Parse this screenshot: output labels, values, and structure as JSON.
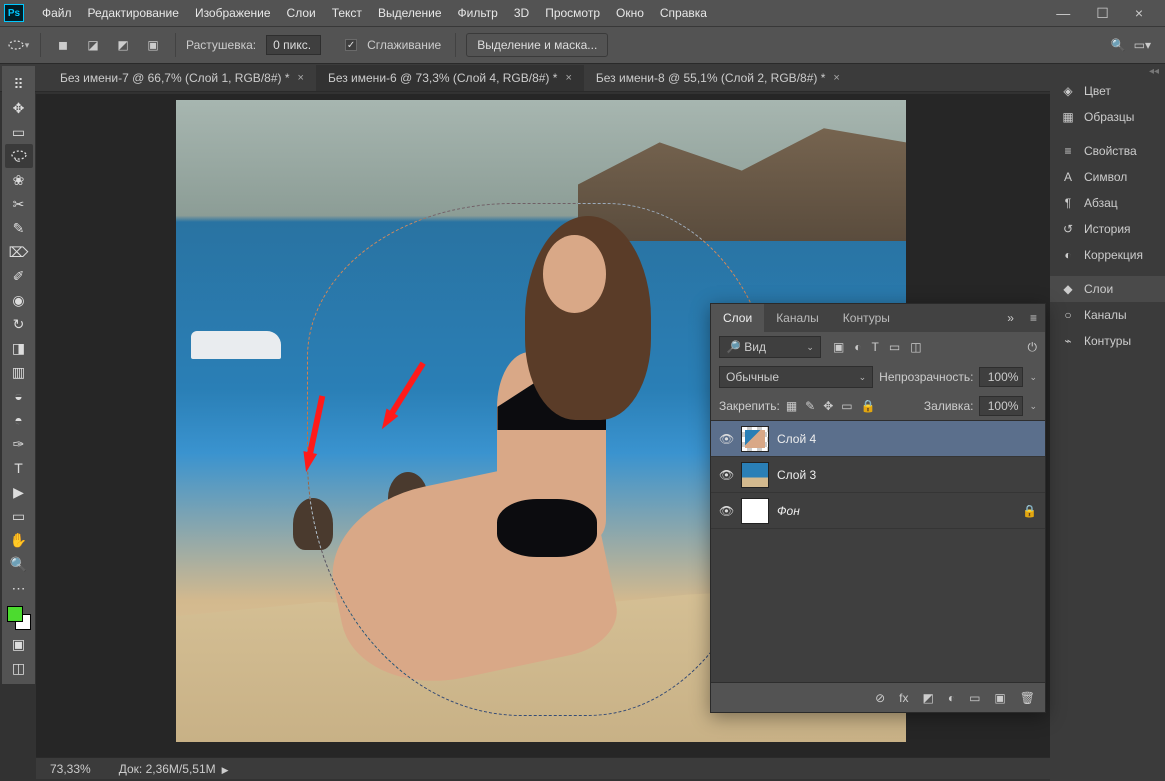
{
  "app": {
    "logo": "Ps"
  },
  "menu": [
    "Файл",
    "Редактирование",
    "Изображение",
    "Слои",
    "Текст",
    "Выделение",
    "Фильтр",
    "3D",
    "Просмотр",
    "Окно",
    "Справка"
  ],
  "window_controls": {
    "minimize": "—",
    "maximize": "☐",
    "close": "×"
  },
  "options": {
    "feather_label": "Растушевка:",
    "feather_value": "0 пикс.",
    "antialias_label": "Сглаживание",
    "antialias_checked": "✓",
    "select_mask_btn": "Выделение и маска..."
  },
  "doc_tabs": [
    {
      "label": "Без имени-7 @ 66,7% (Слой 1, RGB/8#) *",
      "active": false
    },
    {
      "label": "Без имени-6 @ 73,3% (Слой 4, RGB/8#) *",
      "active": true
    },
    {
      "label": "Без имени-8 @ 55,1% (Слой 2, RGB/8#) *",
      "active": false
    }
  ],
  "tools": [
    "↔",
    "▭",
    "◯",
    "○",
    "✦",
    "✂",
    "⁜",
    "✎",
    "⌫",
    "▱",
    "✏",
    "◑",
    "△",
    "●",
    "✍",
    "…",
    "✑",
    "T",
    "▲",
    "▭",
    "✋",
    "🔍"
  ],
  "status": {
    "zoom": "73,33%",
    "doc_label": "Док:",
    "doc_value": "2,36M/5,51M"
  },
  "rail_groups": [
    [
      {
        "icon": "◈",
        "label": "Цвет"
      },
      {
        "icon": "▦",
        "label": "Образцы"
      }
    ],
    [
      {
        "icon": "≡",
        "label": "Свойства"
      },
      {
        "icon": "A",
        "label": "Символ"
      },
      {
        "icon": "¶",
        "label": "Абзац"
      },
      {
        "icon": "↺",
        "label": "История"
      },
      {
        "icon": "◐",
        "label": "Коррекция"
      }
    ],
    [
      {
        "icon": "◆",
        "label": "Слои",
        "active": true
      },
      {
        "icon": "○",
        "label": "Каналы"
      },
      {
        "icon": "⌁",
        "label": "Контуры"
      }
    ]
  ],
  "panel": {
    "tabs": [
      "Слои",
      "Каналы",
      "Контуры"
    ],
    "filter_kind": "Вид",
    "blend_mode": "Обычные",
    "opacity_label": "Непрозрачность:",
    "opacity_value": "100%",
    "lock_label": "Закрепить:",
    "fill_label": "Заливка:",
    "fill_value": "100%",
    "layers": [
      {
        "name": "Слой 4",
        "selected": true,
        "thumb": "chk"
      },
      {
        "name": "Слой 3",
        "thumb": "photo"
      },
      {
        "name": "Фон",
        "locked": true,
        "italic": true,
        "thumb": "white"
      }
    ],
    "filter_icons": [
      "▣",
      "◐",
      "T",
      "▭",
      "◫"
    ],
    "lock_icons": [
      "▦",
      "✎",
      "✥",
      "▭",
      "🔒"
    ],
    "footer_icons": [
      "⊘",
      "fx",
      "◩",
      "◐",
      "▭",
      "▣",
      "🗑"
    ]
  }
}
